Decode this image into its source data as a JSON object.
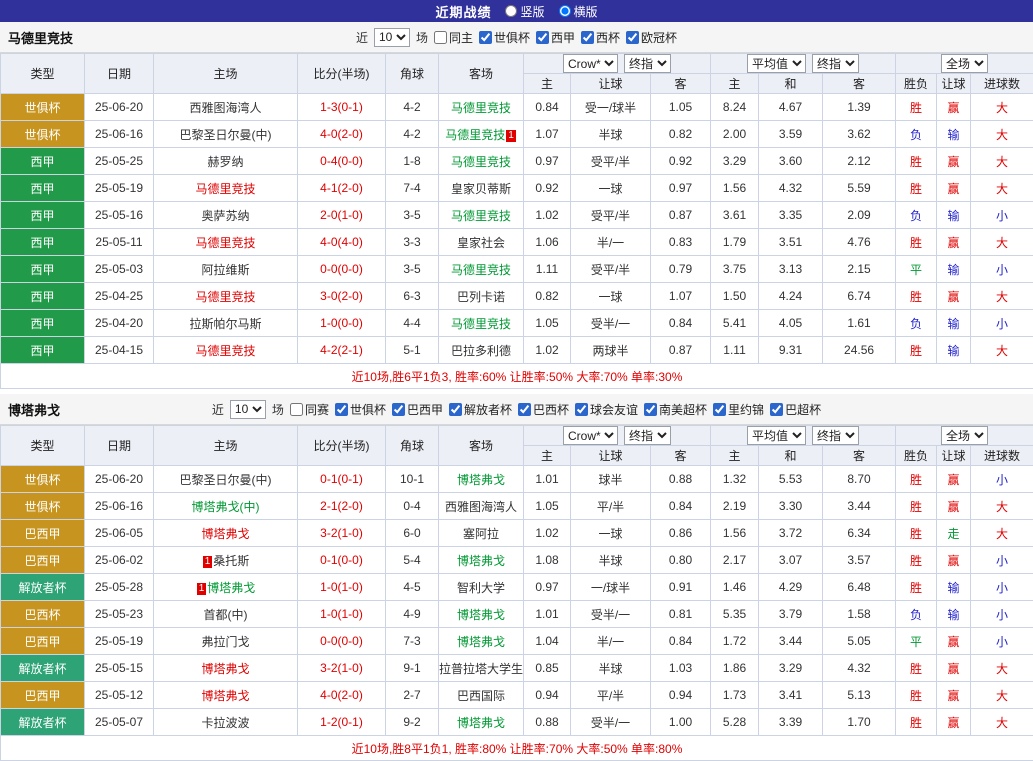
{
  "topbar": {
    "title": "近期战绩",
    "radios": [
      {
        "label": "竖版",
        "selected": false
      },
      {
        "label": "横版",
        "selected": true
      }
    ]
  },
  "palette": {
    "topbar_bg": "#31319c",
    "win_red": "#e00000",
    "lose_blue": "#2222cc",
    "draw_green": "#009933",
    "gold_competition": "#c6941f",
    "green_competition": "#219b49",
    "teal_competition": "#2da376",
    "header_bg": "#edeff7"
  },
  "table_legend": {
    "left_cols": [
      "类型",
      "日期",
      "主场",
      "比分(半场)",
      "角球",
      "客场"
    ],
    "asian_cols": [
      "主",
      "让球",
      "客"
    ],
    "euro_cols": [
      "主",
      "和",
      "客"
    ],
    "result_cols": [
      "胜负",
      "让球",
      "进球数"
    ]
  },
  "sections": [
    {
      "team": "马德里竞技",
      "filter": {
        "near_label": "近",
        "count": "10",
        "matches_label": "场",
        "same": {
          "label": "同主",
          "checked": false
        },
        "leagues": [
          {
            "label": "世俱杯",
            "checked": true
          },
          {
            "label": "西甲",
            "checked": true
          },
          {
            "label": "西杯",
            "checked": true
          },
          {
            "label": "欧冠杯",
            "checked": true
          }
        ]
      },
      "dropdowns": {
        "asian_company": "Crow*",
        "asian_type": "终指",
        "euro_company": "平均值",
        "euro_type": "终指",
        "scope": "全场"
      },
      "rows": [
        {
          "type": "世俱杯",
          "type_cls": "gold",
          "date": "25-06-20",
          "home": {
            "name": "西雅图海湾人",
            "cls": ""
          },
          "score": "1-3(0-1)",
          "corner": "4-2",
          "away": {
            "name": "马德里竞技",
            "cls": "green"
          },
          "asian": [
            "0.84",
            "受一/球半",
            "1.05"
          ],
          "euro": [
            "8.24",
            "4.67",
            "1.39"
          ],
          "results": [
            {
              "t": "胜",
              "c": "red"
            },
            {
              "t": "赢",
              "c": "red"
            },
            {
              "t": "大",
              "c": "red"
            }
          ]
        },
        {
          "type": "世俱杯",
          "type_cls": "gold",
          "date": "25-06-16",
          "home": {
            "name": "巴黎圣日尔曼(中)",
            "cls": ""
          },
          "score": "4-0(2-0)",
          "corner": "4-2",
          "away": {
            "name": "马德里竞技",
            "cls": "green",
            "badge": "1",
            "badge_side": "right"
          },
          "asian": [
            "1.07",
            "半球",
            "0.82"
          ],
          "euro": [
            "2.00",
            "3.59",
            "3.62"
          ],
          "results": [
            {
              "t": "负",
              "c": "blue"
            },
            {
              "t": "输",
              "c": "blue"
            },
            {
              "t": "大",
              "c": "red"
            }
          ]
        },
        {
          "type": "西甲",
          "type_cls": "green",
          "date": "25-05-25",
          "home": {
            "name": "赫罗纳",
            "cls": ""
          },
          "score": "0-4(0-0)",
          "corner": "1-8",
          "away": {
            "name": "马德里竞技",
            "cls": "green"
          },
          "asian": [
            "0.97",
            "受平/半",
            "0.92"
          ],
          "euro": [
            "3.29",
            "3.60",
            "2.12"
          ],
          "results": [
            {
              "t": "胜",
              "c": "red"
            },
            {
              "t": "赢",
              "c": "red"
            },
            {
              "t": "大",
              "c": "red"
            }
          ]
        },
        {
          "type": "西甲",
          "type_cls": "green",
          "date": "25-05-19",
          "home": {
            "name": "马德里竞技",
            "cls": "red"
          },
          "score": "4-1(2-0)",
          "corner": "7-4",
          "away": {
            "name": "皇家贝蒂斯",
            "cls": ""
          },
          "asian": [
            "0.92",
            "一球",
            "0.97"
          ],
          "euro": [
            "1.56",
            "4.32",
            "5.59"
          ],
          "results": [
            {
              "t": "胜",
              "c": "red"
            },
            {
              "t": "赢",
              "c": "red"
            },
            {
              "t": "大",
              "c": "red"
            }
          ]
        },
        {
          "type": "西甲",
          "type_cls": "green",
          "date": "25-05-16",
          "home": {
            "name": "奥萨苏纳",
            "cls": ""
          },
          "score": "2-0(1-0)",
          "corner": "3-5",
          "away": {
            "name": "马德里竞技",
            "cls": "green"
          },
          "asian": [
            "1.02",
            "受平/半",
            "0.87"
          ],
          "euro": [
            "3.61",
            "3.35",
            "2.09"
          ],
          "results": [
            {
              "t": "负",
              "c": "blue"
            },
            {
              "t": "输",
              "c": "blue"
            },
            {
              "t": "小",
              "c": "blue"
            }
          ]
        },
        {
          "type": "西甲",
          "type_cls": "green",
          "date": "25-05-11",
          "home": {
            "name": "马德里竞技",
            "cls": "red"
          },
          "score": "4-0(4-0)",
          "corner": "3-3",
          "away": {
            "name": "皇家社会",
            "cls": ""
          },
          "asian": [
            "1.06",
            "半/一",
            "0.83"
          ],
          "euro": [
            "1.79",
            "3.51",
            "4.76"
          ],
          "results": [
            {
              "t": "胜",
              "c": "red"
            },
            {
              "t": "赢",
              "c": "red"
            },
            {
              "t": "大",
              "c": "red"
            }
          ]
        },
        {
          "type": "西甲",
          "type_cls": "green",
          "date": "25-05-03",
          "home": {
            "name": "阿拉维斯",
            "cls": ""
          },
          "score": "0-0(0-0)",
          "corner": "3-5",
          "away": {
            "name": "马德里竞技",
            "cls": "green"
          },
          "asian": [
            "1.11",
            "受平/半",
            "0.79"
          ],
          "euro": [
            "3.75",
            "3.13",
            "2.15"
          ],
          "results": [
            {
              "t": "平",
              "c": "green"
            },
            {
              "t": "输",
              "c": "blue"
            },
            {
              "t": "小",
              "c": "blue"
            }
          ]
        },
        {
          "type": "西甲",
          "type_cls": "green",
          "date": "25-04-25",
          "home": {
            "name": "马德里竞技",
            "cls": "red"
          },
          "score": "3-0(2-0)",
          "corner": "6-3",
          "away": {
            "name": "巴列卡诺",
            "cls": ""
          },
          "asian": [
            "0.82",
            "一球",
            "1.07"
          ],
          "euro": [
            "1.50",
            "4.24",
            "6.74"
          ],
          "results": [
            {
              "t": "胜",
              "c": "red"
            },
            {
              "t": "赢",
              "c": "red"
            },
            {
              "t": "大",
              "c": "red"
            }
          ]
        },
        {
          "type": "西甲",
          "type_cls": "green",
          "date": "25-04-20",
          "home": {
            "name": "拉斯帕尔马斯",
            "cls": ""
          },
          "score": "1-0(0-0)",
          "corner": "4-4",
          "away": {
            "name": "马德里竞技",
            "cls": "green"
          },
          "asian": [
            "1.05",
            "受半/一",
            "0.84"
          ],
          "euro": [
            "5.41",
            "4.05",
            "1.61"
          ],
          "results": [
            {
              "t": "负",
              "c": "blue"
            },
            {
              "t": "输",
              "c": "blue"
            },
            {
              "t": "小",
              "c": "blue"
            }
          ]
        },
        {
          "type": "西甲",
          "type_cls": "green",
          "date": "25-04-15",
          "home": {
            "name": "马德里竞技",
            "cls": "red"
          },
          "score": "4-2(2-1)",
          "corner": "5-1",
          "away": {
            "name": "巴拉多利德",
            "cls": ""
          },
          "asian": [
            "1.02",
            "两球半",
            "0.87"
          ],
          "euro": [
            "1.11",
            "9.31",
            "24.56"
          ],
          "results": [
            {
              "t": "胜",
              "c": "red"
            },
            {
              "t": "输",
              "c": "blue"
            },
            {
              "t": "大",
              "c": "red"
            }
          ]
        }
      ],
      "summary": "近10场,胜6平1负3, 胜率:60% 让胜率:50% 大率:70% 单率:30%"
    },
    {
      "team": "博塔弗戈",
      "filter": {
        "near_label": "近",
        "count": "10",
        "matches_label": "场",
        "same": {
          "label": "同赛",
          "checked": false
        },
        "leagues": [
          {
            "label": "世俱杯",
            "checked": true
          },
          {
            "label": "巴西甲",
            "checked": true
          },
          {
            "label": "解放者杯",
            "checked": true
          },
          {
            "label": "巴西杯",
            "checked": true
          },
          {
            "label": "球会友谊",
            "checked": true
          },
          {
            "label": "南美超杯",
            "checked": true
          },
          {
            "label": "里约锦",
            "checked": true
          },
          {
            "label": "巴超杯",
            "checked": true
          }
        ]
      },
      "dropdowns": {
        "asian_company": "Crow*",
        "asian_type": "终指",
        "euro_company": "平均值",
        "euro_type": "终指",
        "scope": "全场"
      },
      "rows": [
        {
          "type": "世俱杯",
          "type_cls": "gold",
          "date": "25-06-20",
          "home": {
            "name": "巴黎圣日尔曼(中)",
            "cls": ""
          },
          "score": "0-1(0-1)",
          "corner": "10-1",
          "away": {
            "name": "博塔弗戈",
            "cls": "green"
          },
          "asian": [
            "1.01",
            "球半",
            "0.88"
          ],
          "euro": [
            "1.32",
            "5.53",
            "8.70"
          ],
          "results": [
            {
              "t": "胜",
              "c": "red"
            },
            {
              "t": "赢",
              "c": "red"
            },
            {
              "t": "小",
              "c": "blue"
            }
          ]
        },
        {
          "type": "世俱杯",
          "type_cls": "gold",
          "date": "25-06-16",
          "home": {
            "name": "博塔弗戈(中)",
            "cls": "green"
          },
          "score": "2-1(2-0)",
          "corner": "0-4",
          "away": {
            "name": "西雅图海湾人",
            "cls": ""
          },
          "asian": [
            "1.05",
            "平/半",
            "0.84"
          ],
          "euro": [
            "2.19",
            "3.30",
            "3.44"
          ],
          "results": [
            {
              "t": "胜",
              "c": "red"
            },
            {
              "t": "赢",
              "c": "red"
            },
            {
              "t": "大",
              "c": "red"
            }
          ]
        },
        {
          "type": "巴西甲",
          "type_cls": "gold",
          "date": "25-06-05",
          "home": {
            "name": "博塔弗戈",
            "cls": "red"
          },
          "score": "3-2(1-0)",
          "corner": "6-0",
          "away": {
            "name": "塞阿拉",
            "cls": ""
          },
          "asian": [
            "1.02",
            "一球",
            "0.86"
          ],
          "euro": [
            "1.56",
            "3.72",
            "6.34"
          ],
          "results": [
            {
              "t": "胜",
              "c": "red"
            },
            {
              "t": "走",
              "c": "green"
            },
            {
              "t": "大",
              "c": "red"
            }
          ]
        },
        {
          "type": "巴西甲",
          "type_cls": "gold",
          "date": "25-06-02",
          "home": {
            "name": "桑托斯",
            "cls": "",
            "badge": "1",
            "badge_side": "left"
          },
          "score": "0-1(0-0)",
          "corner": "5-4",
          "away": {
            "name": "博塔弗戈",
            "cls": "green"
          },
          "asian": [
            "1.08",
            "半球",
            "0.80"
          ],
          "euro": [
            "2.17",
            "3.07",
            "3.57"
          ],
          "results": [
            {
              "t": "胜",
              "c": "red"
            },
            {
              "t": "赢",
              "c": "red"
            },
            {
              "t": "小",
              "c": "blue"
            }
          ]
        },
        {
          "type": "解放者杯",
          "type_cls": "teal",
          "date": "25-05-28",
          "home": {
            "name": "博塔弗戈",
            "cls": "green",
            "badge": "1",
            "badge_side": "left"
          },
          "score": "1-0(1-0)",
          "corner": "4-5",
          "away": {
            "name": "智利大学",
            "cls": ""
          },
          "asian": [
            "0.97",
            "一/球半",
            "0.91"
          ],
          "euro": [
            "1.46",
            "4.29",
            "6.48"
          ],
          "results": [
            {
              "t": "胜",
              "c": "red"
            },
            {
              "t": "输",
              "c": "blue"
            },
            {
              "t": "小",
              "c": "blue"
            }
          ]
        },
        {
          "type": "巴西杯",
          "type_cls": "gold",
          "date": "25-05-23",
          "home": {
            "name": "首都(中)",
            "cls": ""
          },
          "score": "1-0(1-0)",
          "corner": "4-9",
          "away": {
            "name": "博塔弗戈",
            "cls": "green"
          },
          "asian": [
            "1.01",
            "受半/一",
            "0.81"
          ],
          "euro": [
            "5.35",
            "3.79",
            "1.58"
          ],
          "results": [
            {
              "t": "负",
              "c": "blue"
            },
            {
              "t": "输",
              "c": "blue"
            },
            {
              "t": "小",
              "c": "blue"
            }
          ]
        },
        {
          "type": "巴西甲",
          "type_cls": "gold",
          "date": "25-05-19",
          "home": {
            "name": "弗拉门戈",
            "cls": ""
          },
          "score": "0-0(0-0)",
          "corner": "7-3",
          "away": {
            "name": "博塔弗戈",
            "cls": "green"
          },
          "asian": [
            "1.04",
            "半/一",
            "0.84"
          ],
          "euro": [
            "1.72",
            "3.44",
            "5.05"
          ],
          "results": [
            {
              "t": "平",
              "c": "green"
            },
            {
              "t": "赢",
              "c": "red"
            },
            {
              "t": "小",
              "c": "blue"
            }
          ]
        },
        {
          "type": "解放者杯",
          "type_cls": "teal",
          "date": "25-05-15",
          "home": {
            "name": "博塔弗戈",
            "cls": "red"
          },
          "score": "3-2(1-0)",
          "corner": "9-1",
          "away": {
            "name": "拉普拉塔大学生",
            "cls": ""
          },
          "asian": [
            "0.85",
            "半球",
            "1.03"
          ],
          "euro": [
            "1.86",
            "3.29",
            "4.32"
          ],
          "results": [
            {
              "t": "胜",
              "c": "red"
            },
            {
              "t": "赢",
              "c": "red"
            },
            {
              "t": "大",
              "c": "red"
            }
          ]
        },
        {
          "type": "巴西甲",
          "type_cls": "gold",
          "date": "25-05-12",
          "home": {
            "name": "博塔弗戈",
            "cls": "red"
          },
          "score": "4-0(2-0)",
          "corner": "2-7",
          "away": {
            "name": "巴西国际",
            "cls": ""
          },
          "asian": [
            "0.94",
            "平/半",
            "0.94"
          ],
          "euro": [
            "1.73",
            "3.41",
            "5.13"
          ],
          "results": [
            {
              "t": "胜",
              "c": "red"
            },
            {
              "t": "赢",
              "c": "red"
            },
            {
              "t": "大",
              "c": "red"
            }
          ]
        },
        {
          "type": "解放者杯",
          "type_cls": "teal",
          "date": "25-05-07",
          "home": {
            "name": "卡拉波波",
            "cls": ""
          },
          "score": "1-2(0-1)",
          "corner": "9-2",
          "away": {
            "name": "博塔弗戈",
            "cls": "green"
          },
          "asian": [
            "0.88",
            "受半/一",
            "1.00"
          ],
          "euro": [
            "5.28",
            "3.39",
            "1.70"
          ],
          "results": [
            {
              "t": "胜",
              "c": "red"
            },
            {
              "t": "赢",
              "c": "red"
            },
            {
              "t": "大",
              "c": "red"
            }
          ]
        }
      ],
      "summary": "近10场,胜8平1负1, 胜率:80% 让胜率:70% 大率:50% 单率:80%"
    }
  ]
}
